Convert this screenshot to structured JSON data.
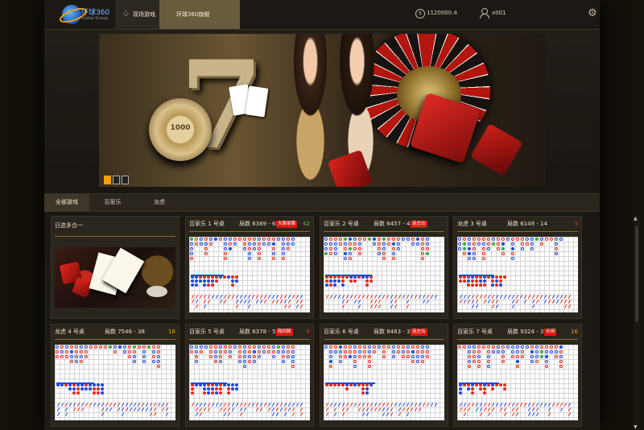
{
  "header": {
    "brand_name": "环球360",
    "brand_sub": "Global Group",
    "nav_live_label": "现场游戏",
    "nav_flagship_label": "环球360旗舰",
    "balance_symbol": "$",
    "balance": "1120000.4",
    "username": "x001"
  },
  "banner": {
    "slides": 3,
    "active_slide": 1
  },
  "tabs": [
    {
      "label": "全部游戏",
      "active": true
    },
    {
      "label": "百家乐",
      "active": false
    },
    {
      "label": "龙虎",
      "active": false
    }
  ],
  "lobby": {
    "multi_title": "日选多合一"
  },
  "tables": [
    {
      "name": "百家乐 1 号桌",
      "count": "局数 6389 - 64",
      "tag": "大路单跳",
      "num": "42",
      "num_color": "green"
    },
    {
      "name": "百家乐 2 号桌",
      "count": "局数 6457 - 45",
      "tag": "连庄出",
      "num": "",
      "num_color": ""
    },
    {
      "name": "龙虎 3 号桌",
      "count": "局数 6149 - 14",
      "tag": "",
      "num": "5",
      "num_color": "red"
    },
    {
      "name": "龙虎 4 号桌",
      "count": "局数 7546 - 38",
      "tag": "",
      "num": "16",
      "num_color": "orange"
    },
    {
      "name": "百家乐 5 号桌",
      "count": "局数 6378 - 54",
      "tag": "隔到跳",
      "num": "9",
      "num_color": "red"
    },
    {
      "name": "百家乐 6 号桌",
      "count": "局数 8463 - 30",
      "tag": "连庄出",
      "num": "",
      "num_color": ""
    },
    {
      "name": "百家乐 7 号桌",
      "count": "局数 9324 - 36",
      "tag": "长闲",
      "num": "16",
      "num_color": "orange"
    }
  ],
  "colors": {
    "accent": "#f0a10c",
    "banker_red": "#e12a1a",
    "player_blue": "#2048d8",
    "tie_green": "#3da83d"
  }
}
